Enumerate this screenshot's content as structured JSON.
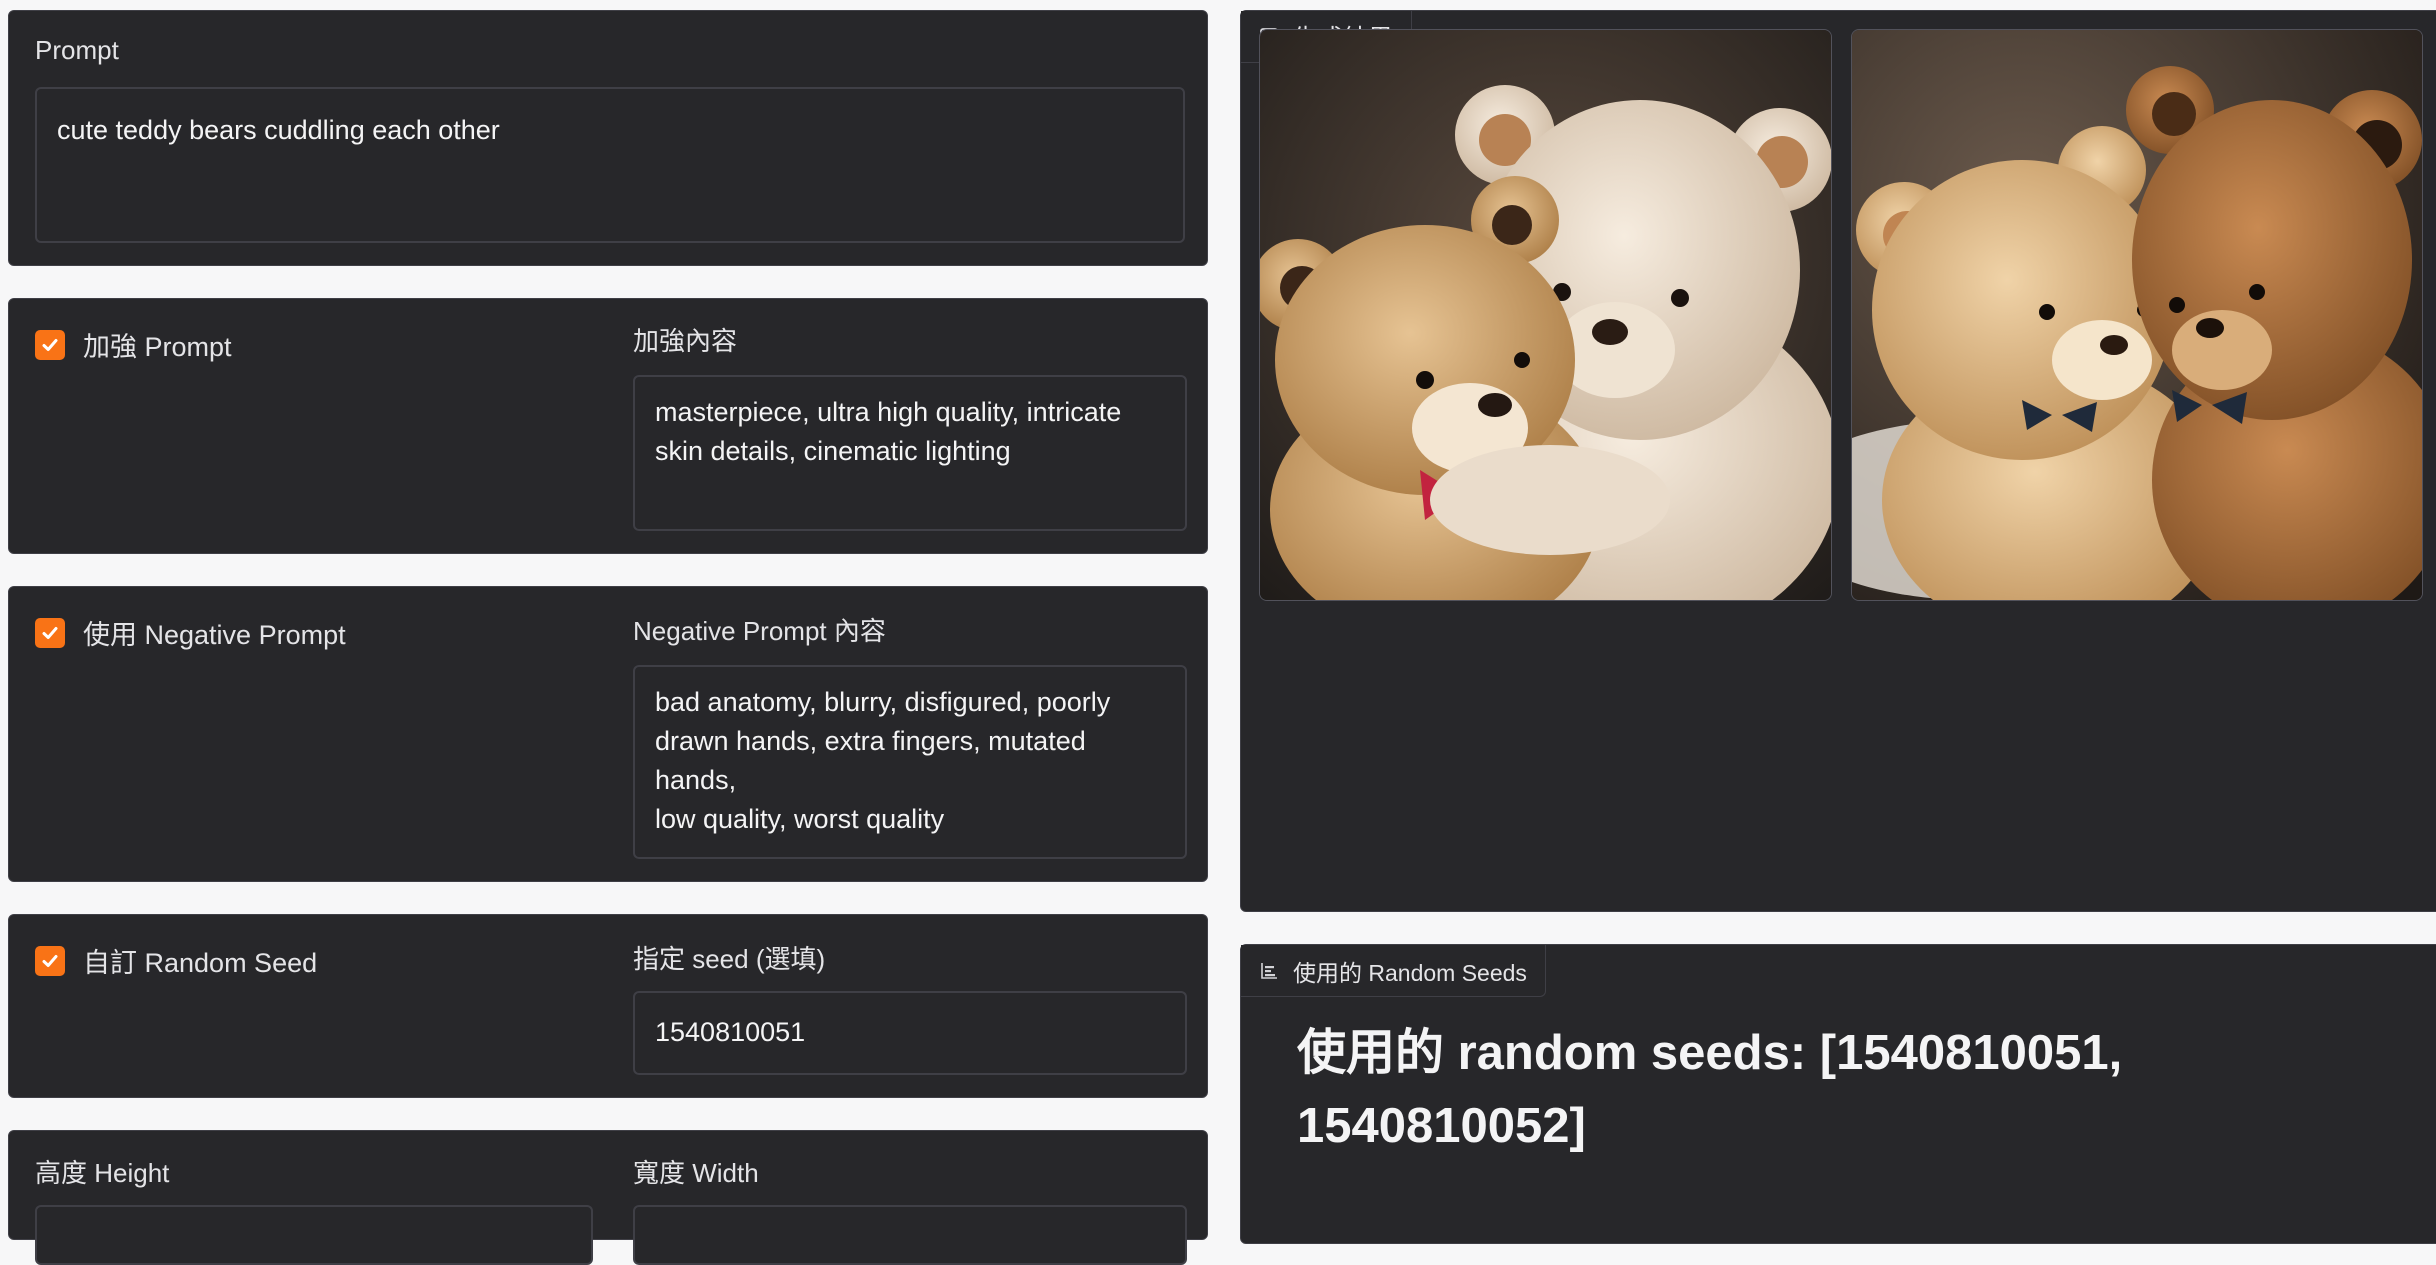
{
  "prompt": {
    "label": "Prompt",
    "value": "cute teddy bears cuddling each other"
  },
  "enhance": {
    "checkbox_label": "加強 Prompt",
    "checked": true,
    "content_label": "加強內容",
    "content_value": "masterpiece, ultra high quality, intricate\nskin details, cinematic lighting"
  },
  "negative": {
    "checkbox_label": "使用 Negative Prompt",
    "checked": true,
    "content_label": "Negative Prompt 內容",
    "content_value": "bad anatomy, blurry, disfigured, poorly\ndrawn hands, extra fingers, mutated hands,\nlow quality, worst quality"
  },
  "seed": {
    "checkbox_label": "自訂 Random Seed",
    "checked": true,
    "content_label": "指定 seed (選填)",
    "content_value": "1540810051"
  },
  "size": {
    "height_label": "高度 Height",
    "width_label": "寬度 Width"
  },
  "results": {
    "tab_label": "生成結果",
    "tab_icon": "image-icon",
    "images": [
      {
        "alt": "teddy-bears-image-1"
      },
      {
        "alt": "teddy-bears-image-2"
      }
    ]
  },
  "seeds_output": {
    "tab_label": "使用的 Random Seeds",
    "tab_icon": "bar-chart-icon",
    "text": "使用的 random seeds: [1540810051, 1540810052]"
  },
  "colors": {
    "accent": "#f97316",
    "panel_bg": "#27272a",
    "page_bg": "#f7f7f8"
  }
}
